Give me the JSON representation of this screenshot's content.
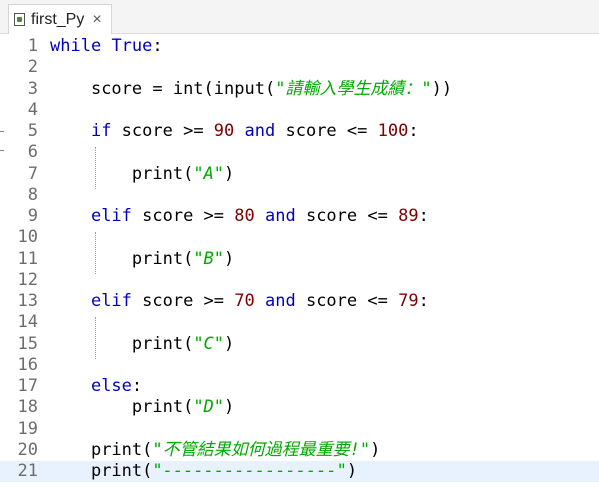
{
  "tab": {
    "title": "first_Py",
    "close": "×",
    "icon": "python-file-icon"
  },
  "lines": [
    {
      "n": "1",
      "indent": "",
      "tokens": [
        [
          "kw",
          "while"
        ],
        [
          "t",
          " "
        ],
        [
          "kw",
          "True"
        ],
        [
          "t",
          ":"
        ]
      ]
    },
    {
      "n": "2",
      "indent": "",
      "tokens": []
    },
    {
      "n": "3",
      "indent": "    ",
      "tokens": [
        [
          "t",
          "score = int(input("
        ],
        [
          "str",
          "\"請輸入學生成績：\""
        ],
        [
          "t",
          "))"
        ]
      ]
    },
    {
      "n": "4",
      "indent": "",
      "tokens": []
    },
    {
      "n": "5",
      "indent": "    ",
      "tokens": [
        [
          "kw",
          "if"
        ],
        [
          "t",
          " score >= "
        ],
        [
          "num",
          "90"
        ],
        [
          "t",
          " "
        ],
        [
          "kw",
          "and"
        ],
        [
          "t",
          " score <= "
        ],
        [
          "num",
          "100"
        ],
        [
          "t",
          ":"
        ]
      ]
    },
    {
      "n": "6",
      "indent": "",
      "tokens": []
    },
    {
      "n": "7",
      "indent": "        ",
      "tokens": [
        [
          "t",
          "print("
        ],
        [
          "str",
          "\"A\""
        ],
        [
          "t",
          ")"
        ]
      ]
    },
    {
      "n": "8",
      "indent": "",
      "tokens": []
    },
    {
      "n": "9",
      "indent": "    ",
      "tokens": [
        [
          "kw",
          "elif"
        ],
        [
          "t",
          " score >= "
        ],
        [
          "num",
          "80"
        ],
        [
          "t",
          " "
        ],
        [
          "kw",
          "and"
        ],
        [
          "t",
          " score <= "
        ],
        [
          "num",
          "89"
        ],
        [
          "t",
          ":"
        ]
      ]
    },
    {
      "n": "10",
      "indent": "",
      "tokens": []
    },
    {
      "n": "11",
      "indent": "        ",
      "tokens": [
        [
          "t",
          "print("
        ],
        [
          "str",
          "\"B\""
        ],
        [
          "t",
          ")"
        ]
      ]
    },
    {
      "n": "12",
      "indent": "",
      "tokens": []
    },
    {
      "n": "13",
      "indent": "    ",
      "tokens": [
        [
          "kw",
          "elif"
        ],
        [
          "t",
          " score >= "
        ],
        [
          "num",
          "70"
        ],
        [
          "t",
          " "
        ],
        [
          "kw",
          "and"
        ],
        [
          "t",
          " score <= "
        ],
        [
          "num",
          "79"
        ],
        [
          "t",
          ":"
        ]
      ]
    },
    {
      "n": "14",
      "indent": "",
      "tokens": []
    },
    {
      "n": "15",
      "indent": "        ",
      "tokens": [
        [
          "t",
          "print("
        ],
        [
          "str",
          "\"C\""
        ],
        [
          "t",
          ")"
        ]
      ]
    },
    {
      "n": "16",
      "indent": "",
      "tokens": []
    },
    {
      "n": "17",
      "indent": "    ",
      "tokens": [
        [
          "kw",
          "else"
        ],
        [
          "t",
          ":"
        ]
      ]
    },
    {
      "n": "18",
      "indent": "        ",
      "tokens": [
        [
          "t",
          "print("
        ],
        [
          "str",
          "\"D\""
        ],
        [
          "t",
          ")"
        ]
      ]
    },
    {
      "n": "19",
      "indent": "",
      "tokens": []
    },
    {
      "n": "20",
      "indent": "    ",
      "tokens": [
        [
          "t",
          "print("
        ],
        [
          "str",
          "\"不管結果如何過程最重要!\""
        ],
        [
          "t",
          ")"
        ]
      ]
    },
    {
      "n": "21",
      "indent": "    ",
      "tokens": [
        [
          "t",
          "print("
        ],
        [
          "str",
          "\"-----------------\""
        ],
        [
          "t",
          ")"
        ]
      ],
      "current": true
    }
  ],
  "colors": {
    "keyword": "#0000c0",
    "number": "#7f0000",
    "string": "#00aa00",
    "current_line": "#e8f2fe"
  }
}
